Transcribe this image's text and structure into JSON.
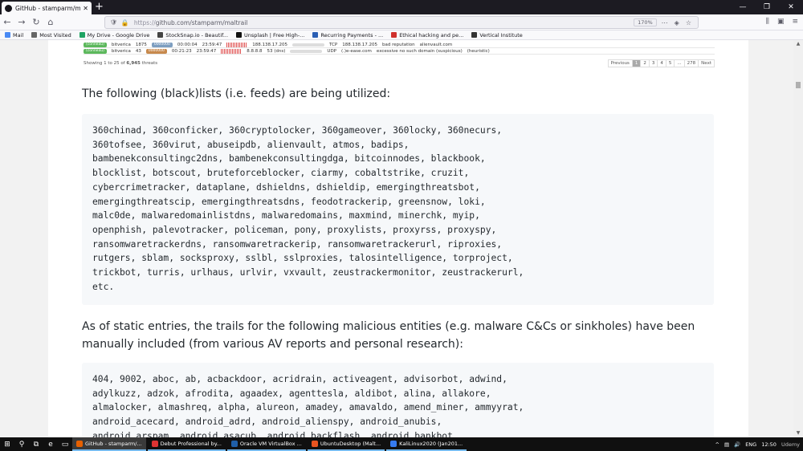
{
  "browser": {
    "tab_title": "GitHub - stamparm/maltrail: M",
    "url_scheme": "https://",
    "url": "github.com/stamparm/maltrail",
    "zoom": "170%",
    "new_tab": "+",
    "minimize": "—",
    "maximize": "❐",
    "close": "✕"
  },
  "bookmarks": [
    {
      "label": "Mail",
      "color": "#4a8af4"
    },
    {
      "label": "Most Visited",
      "color": "#666666"
    },
    {
      "label": "My Drive - Google Drive",
      "color": "#1fa463"
    },
    {
      "label": "StockSnap.io - Beautif...",
      "color": "#444444"
    },
    {
      "label": "Unsplash | Free High-...",
      "color": "#111111"
    },
    {
      "label": "Recurring Payments - ...",
      "color": "#2b5fb4"
    },
    {
      "label": "Ethical hacking and pe...",
      "color": "#d0312d"
    },
    {
      "label": "Vertical Institute",
      "color": "#333333"
    }
  ],
  "threat_table": {
    "rows": [
      {
        "tag": "(conneau)",
        "tag_color": "#5cb85c",
        "sensor": "bitverica",
        "count": "1875",
        "label2": "0000000",
        "time1": "00:00:04",
        "time2": "23:59:47",
        "src": "188.138.17.205",
        "proto": "TCP",
        "dst": "188.138.17.205",
        "info": "bad reputation",
        "ref": "alienvault.com"
      },
      {
        "tag": "(conneau)",
        "tag_color": "#5cb85c",
        "sensor": "bitverica",
        "count": "43",
        "label2": "0000000",
        "time1": "00:21:23",
        "time2": "23:59:47",
        "src": "8.8.8.8",
        "extra": "53 (dns)",
        "proto": "UDP",
        "dst": "(.)e-ease.com",
        "info": "excessive no such domain (suspicious)",
        "ref": "(heuristic)"
      }
    ],
    "showing_prefix": "Showing 1 to 25 of",
    "total": "6,945",
    "showing_suffix": "threats",
    "pager": [
      "Previous",
      "1",
      "2",
      "3",
      "4",
      "5",
      "...",
      "278",
      "Next"
    ]
  },
  "section1": {
    "intro": "The following (black)lists (i.e. feeds) are being utilized:",
    "code": "360chinad, 360conficker, 360cryptolocker, 360gameover, 360locky, 360necurs,\n360tofsee, 360virut, abuseipdb, alienvault, atmos, badips,\nbambenekconsultingc2dns, bambenekconsultingdga, bitcoinnodes, blackbook,\nblocklist, botscout, bruteforceblocker, ciarmy, cobaltstrike, cruzit,\ncybercrimetracker, dataplane, dshieldns, dshieldip, emergingthreatsbot,\nemergingthreatscip, emergingthreatsdns, feodotrackerip, greensnow, loki,\nmalc0de, malwaredomainlistdns, malwaredomains, maxmind, minerchk, myip,\nopenphish, palevotracker, policeman, pony, proxylists, proxyrss, proxyspy,\nransomwaretrackerdns, ransomwaretrackerip, ransomwaretrackerurl, riproxies,\nrutgers, sblam, socksproxy, sslbl, sslproxies, talosintelligence, torproject,\ntrickbot, turris, urlhaus, urlvir, vxvault, zeustrackermonitor, zeustrackerurl,\netc."
  },
  "section2": {
    "intro": "As of static entries, the trails for the following malicious entities (e.g. malware C&Cs or sinkholes) have been manually included (from various AV reports and personal research):",
    "code": "404, 9002, aboc, ab, acbackdoor, acridrain, activeagent, advisorbot, adwind,\nadylkuzz, adzok, afrodita, agaadex, agenttesla, aldibot, alina, allakore,\nalmalocker, almashreq, alpha, alureon, amadey, amavaldo, amend_miner, ammyyrat,\nandroid_acecard, android_adrd, android_alienspy, android_anubis,\nandroid_arspam, android_asacub, android_backflash, android_bankbot,"
  },
  "taskbar": {
    "apps": [
      {
        "label": "GitHub - stamparm/...",
        "color": "#e66000",
        "active": true
      },
      {
        "label": "Debut Professional by...",
        "color": "#d33"
      },
      {
        "label": "Oracle VM VirtualBox ...",
        "color": "#1f5fa8"
      },
      {
        "label": "UbuntuDesktop (Malt...",
        "color": "#e95420"
      },
      {
        "label": "KaliLinux2020 (Jan201...",
        "color": "#367bf0"
      }
    ],
    "lang": "ENG",
    "time": "12:50",
    "watermark": "Udemy"
  }
}
